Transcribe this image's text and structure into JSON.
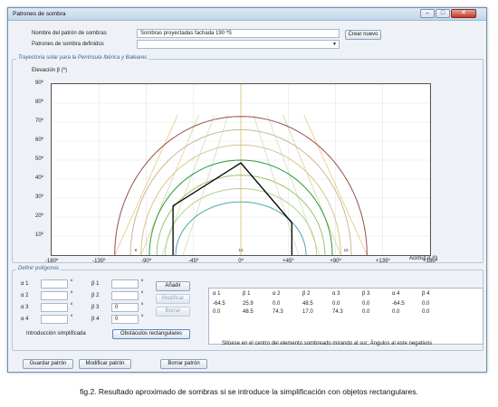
{
  "window": {
    "title": "Patrones de sombra"
  },
  "form": {
    "name_label": "Nombre del patrón de sombras",
    "name_value": "Sombras proyectadas fachada 190 ºS",
    "create_button": "Crear nuevo",
    "defined_label": "Patrones de sombra definidos",
    "defined_value": ""
  },
  "chart_group": {
    "title": "Trayectoria solar para la Península Ibérica y Baleares"
  },
  "chart_data": {
    "type": "line",
    "ylabel": "Elevación β (º)",
    "xlabel": "Acimut α (º)",
    "xlim": [
      -180,
      180
    ],
    "ylim": [
      0,
      90
    ],
    "x_ticks": [
      "-180º",
      "-135º",
      "-90º",
      "-45º",
      "0º",
      "+45º",
      "+90º",
      "+135º",
      "+180º"
    ],
    "y_ticks": [
      "90º",
      "80º",
      "70º",
      "60º",
      "50º",
      "40º",
      "30º",
      "20º",
      "10º"
    ],
    "hour_labels": [
      "8",
      "12",
      "16"
    ],
    "grid": true,
    "sun_paths": [
      {
        "peak": 73,
        "half_width": 120,
        "color": "#9b4c4c"
      },
      {
        "peak": 66,
        "half_width": 105,
        "color": "#c9b79a"
      },
      {
        "peak": 58,
        "half_width": 95,
        "color": "#d9c58e"
      },
      {
        "peak": 50,
        "half_width": 87,
        "color": "#2c9a3c"
      },
      {
        "peak": 42,
        "half_width": 80,
        "color": "#9dc36b"
      },
      {
        "peak": 35,
        "half_width": 72,
        "color": "#b4d28c"
      },
      {
        "peak": 28,
        "half_width": 62,
        "color": "#4fa8a8"
      }
    ],
    "hour_lines": [
      {
        "x1": -120,
        "x2": -60,
        "color": "#e0c36a"
      },
      {
        "x1": -95,
        "x2": -40,
        "color": "#d0d08a"
      },
      {
        "x1": -75,
        "x2": -25,
        "color": "#cfd9b0"
      },
      {
        "x1": -55,
        "x2": -12,
        "color": "#cfd9b0"
      },
      {
        "x1": 120,
        "x2": 60,
        "color": "#e0c36a"
      },
      {
        "x1": 95,
        "x2": 40,
        "color": "#d0d08a"
      },
      {
        "x1": 75,
        "x2": 25,
        "color": "#cfd9b0"
      },
      {
        "x1": 55,
        "x2": 12,
        "color": "#cfd9b0"
      }
    ],
    "polygon": [
      [
        -64.5,
        0
      ],
      [
        -64.5,
        25.9
      ],
      [
        0,
        48.5
      ],
      [
        48.5,
        17.0
      ],
      [
        48.5,
        0
      ]
    ]
  },
  "polygons_group": {
    "title": "Definir polígonos",
    "alpha_labels": [
      "α 1",
      "α 2",
      "α 3",
      "α 4"
    ],
    "beta_labels": [
      "β 1",
      "β 2",
      "β 3",
      "β 4"
    ],
    "degree_symbol": "º",
    "alpha_values": [
      "",
      "",
      "",
      ""
    ],
    "beta_values": [
      "",
      "",
      "0",
      "0"
    ],
    "add_button": "Añadir",
    "modify_button": "Modificar",
    "delete_button": "Borrar",
    "simplified_label": "Introducción simplificada",
    "rect_button": "Obstáculos rectangulares"
  },
  "table": {
    "headers": [
      "α 1",
      "β 1",
      "α 2",
      "β 2",
      "α 3",
      "β 3",
      "α 4",
      "β 4"
    ],
    "rows": [
      [
        "-64.5",
        "25.9",
        "0.0",
        "48.5",
        "0.0",
        "0.0",
        "-64.5",
        "0.0"
      ],
      [
        "0.0",
        "48.5",
        "74.3",
        "17.0",
        "74.3",
        "0.0",
        "0.0",
        "0.0"
      ]
    ],
    "note": "Sitúese en el centro del elemento sombreado mirando al sur; Ángulos al este negativos"
  },
  "footer": {
    "save_button": "Guardar patrón",
    "modify_button": "Modificar patrón",
    "delete_button": "Borrar patrón"
  },
  "caption": "fig.2. Resultado aproximado de sombras si se introduce la simplificación con objetos rectangulares."
}
